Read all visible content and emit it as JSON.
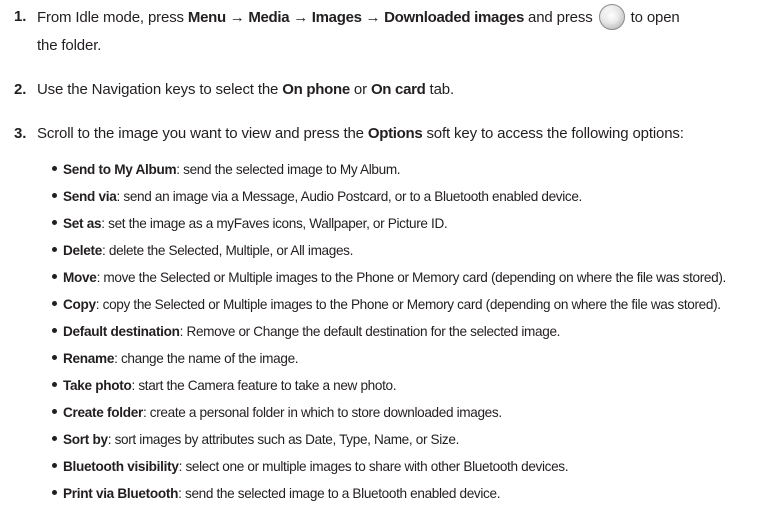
{
  "steps": [
    {
      "number": "1.",
      "parts": {
        "t1": "From Idle mode, press ",
        "b1": "Menu → Media → Images → Downloaded images",
        "t2": " and press ",
        "t3": " to open",
        "t4": "the folder."
      }
    },
    {
      "number": "2.",
      "parts": {
        "t1": "Use the Navigation keys to select the ",
        "b1": "On phone",
        "t2": " or ",
        "b2": "On card",
        "t3": " tab."
      }
    },
    {
      "number": "3.",
      "parts": {
        "t1": "Scroll to the image you want to view and press the ",
        "b1": "Options",
        "t2": " soft key to access the following options:"
      }
    }
  ],
  "icon": "ok-center-key-icon",
  "options": [
    {
      "name": "Send to My Album",
      "desc": ": send the selected image to My Album."
    },
    {
      "name": "Send via",
      "desc": ": send an image via a Message, Audio Postcard, or to a Bluetooth enabled device."
    },
    {
      "name": "Set as",
      "desc": ": set the image as a myFaves icons, Wallpaper, or Picture ID."
    },
    {
      "name": "Delete",
      "desc": ": delete the Selected, Multiple, or All images."
    },
    {
      "name": "Move",
      "desc": ": move the Selected or Multiple images to the Phone or Memory card (depending on where the file was stored)."
    },
    {
      "name": "Copy",
      "desc": ":  copy the Selected or Multiple images to the Phone or Memory card (depending on where the file was stored)."
    },
    {
      "name": "Default destination",
      "desc": ": Remove or Change the default destination for the selected image."
    },
    {
      "name": "Rename",
      "desc": ": change the name of the image."
    },
    {
      "name": "Take photo",
      "desc": ": start the Camera feature to take a new photo."
    },
    {
      "name": "Create folder",
      "desc": ": create a personal folder in which to store downloaded images."
    },
    {
      "name": "Sort by",
      "desc": ": sort images by attributes such as Date, Type, Name, or Size."
    },
    {
      "name": "Bluetooth visibility",
      "desc": ": select one or multiple images to share with other Bluetooth devices."
    },
    {
      "name": "Print via Bluetooth",
      "desc": ": send the selected image to a Bluetooth enabled device."
    }
  ]
}
